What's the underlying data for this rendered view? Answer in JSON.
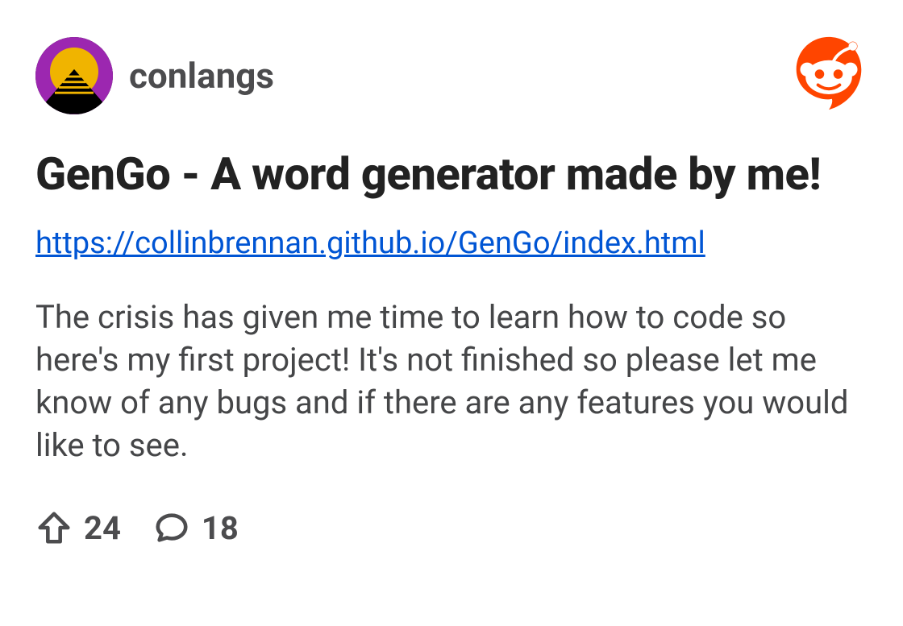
{
  "header": {
    "subreddit_name": "conlangs"
  },
  "post": {
    "title": "GenGo - A word generator made by me!",
    "link_text": "https://collinbrennan.github.io/GenGo/index.html",
    "body": "The crisis has given me time to learn how to code so here's my first project! It's not finished so please let me know of any bugs and if there are any features you would like to see."
  },
  "stats": {
    "upvotes": "24",
    "comments": "18"
  }
}
